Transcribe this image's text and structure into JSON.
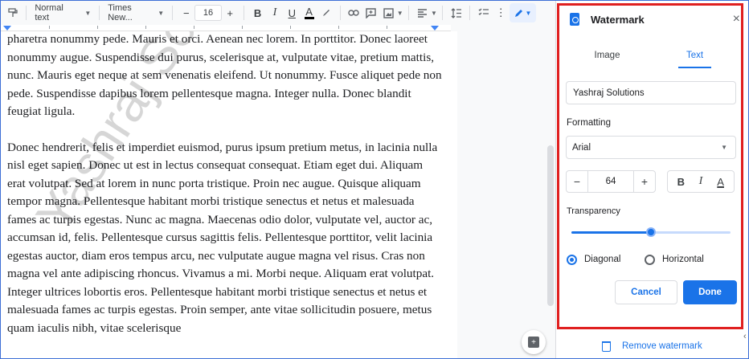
{
  "toolbar": {
    "style": "Normal text",
    "font": "Times New...",
    "size": "16",
    "minus": "−",
    "plus": "+",
    "bold": "B",
    "italic": "I",
    "underline": "U",
    "text_color": "A"
  },
  "document": {
    "paragraphs": [
      "pharetra nonummy pede. Mauris et orci. Aenean nec lorem. In porttitor. Donec laoreet nonummy augue. Suspendisse dui purus, scelerisque at, vulputate vitae, pretium mattis, nunc. Mauris eget neque at sem venenatis eleifend. Ut nonummy. Fusce aliquet pede non pede. Suspendisse dapibus lorem pellentesque magna. Integer nulla. Donec blandit feugiat ligula.",
      "Donec hendrerit, felis et imperdiet euismod, purus ipsum pretium metus, in lacinia nulla nisl eget sapien. Donec ut est in lectus consequat consequat. Etiam eget dui. Aliquam erat volutpat. Sed at lorem in nunc porta tristique. Proin nec augue. Quisque aliquam tempor magna. Pellentesque habitant morbi tristique senectus et netus et malesuada fames ac turpis egestas. Nunc ac magna. Maecenas odio dolor, vulputate vel, auctor ac, accumsan id, felis. Pellentesque cursus sagittis felis. Pellentesque porttitor, velit lacinia egestas auctor, diam eros tempus arcu, nec vulputate augue magna vel risus. Cras non magna vel ante adipiscing rhoncus. Vivamus a mi. Morbi neque. Aliquam erat volutpat. Integer ultrices lobortis eros. Pellentesque habitant morbi tristique senectus et netus et malesuada fames ac turpis egestas. Proin semper, ante vitae sollicitudin posuere, metus quam iaculis nibh, vitae scelerisque"
    ],
    "watermark_text": "Yashraj Solutions"
  },
  "panel": {
    "title": "Watermark",
    "close": "×",
    "tabs": [
      "Image",
      "Text"
    ],
    "active_tab": "Text",
    "text_value": "Yashraj Solutions",
    "formatting_label": "Formatting",
    "font": "Arial",
    "size": "64",
    "minus": "−",
    "plus": "+",
    "bold": "B",
    "italic": "I",
    "color": "A",
    "transparency_label": "Transparency",
    "transparency": 0.5,
    "orientation": [
      {
        "label": "Diagonal",
        "selected": true
      },
      {
        "label": "Horizontal",
        "selected": false
      }
    ],
    "cancel": "Cancel",
    "done": "Done",
    "remove": "Remove watermark"
  },
  "colors": {
    "accent": "#1a73e8",
    "highlight": "#e02020"
  }
}
